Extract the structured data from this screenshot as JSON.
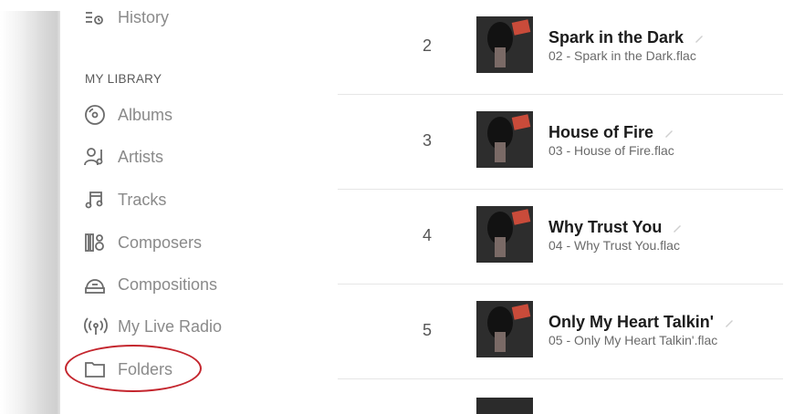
{
  "sidebar": {
    "top_item": "History",
    "section_title": "MY LIBRARY",
    "items": [
      {
        "label": "Albums",
        "icon": "album-disc-icon"
      },
      {
        "label": "Artists",
        "icon": "artist-icon"
      },
      {
        "label": "Tracks",
        "icon": "music-note-icon"
      },
      {
        "label": "Composers",
        "icon": "composer-icon"
      },
      {
        "label": "Compositions",
        "icon": "composition-icon"
      },
      {
        "label": "My Live Radio",
        "icon": "radio-broadcast-icon"
      },
      {
        "label": "Folders",
        "icon": "folder-icon"
      }
    ],
    "highlight_color": "#c4262e"
  },
  "tracks": [
    {
      "number": "2",
      "title": "Spark in the Dark",
      "file": "02 - Spark in the Dark.flac"
    },
    {
      "number": "3",
      "title": "House of Fire",
      "file": "03 - House of Fire.flac"
    },
    {
      "number": "4",
      "title": "Why Trust You",
      "file": "04 - Why Trust You.flac"
    },
    {
      "number": "5",
      "title": "Only My Heart Talkin'",
      "file": "05 - Only My Heart Talkin'.flac"
    }
  ]
}
